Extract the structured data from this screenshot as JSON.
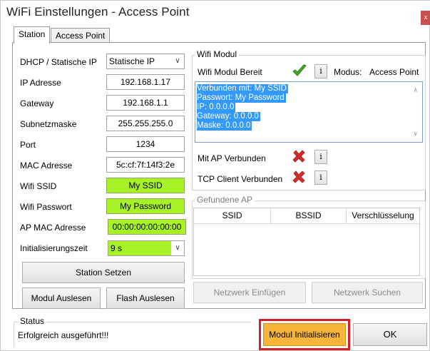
{
  "window": {
    "title": "WiFi Einstellungen - Access Point",
    "close_label": "x"
  },
  "tabs": [
    {
      "label": "Station",
      "active": true
    },
    {
      "label": "Access Point",
      "active": false
    }
  ],
  "station": {
    "fields": {
      "dhcp": {
        "label": "DHCP / Statische IP",
        "value": "Statische IP"
      },
      "ip": {
        "label": "IP Adresse",
        "value": "192.168.1.17"
      },
      "gateway": {
        "label": "Gateway",
        "value": "192.168.1.1"
      },
      "subnet": {
        "label": "Subnetzmaske",
        "value": "255.255.255.0"
      },
      "port": {
        "label": "Port",
        "value": "1234"
      },
      "mac": {
        "label": "MAC Adresse",
        "value": "5c:cf:7f:14f3:2e"
      },
      "ssid": {
        "label": "Wifi SSID",
        "value": "My SSID"
      },
      "password": {
        "label": "Wifi Passwort",
        "value": "My Password"
      },
      "ap_mac": {
        "label": "AP MAC Adresse",
        "value": "00:00:00:00:00:00"
      },
      "init_time": {
        "label": "Initialisierungszeit",
        "value": "9 s"
      }
    },
    "buttons": {
      "station_setzen": "Station Setzen",
      "modul_auslesen": "Modul Auslesen",
      "flash_auslesen": "Flash Auslesen"
    }
  },
  "wifi_modul": {
    "group_title": "Wifi Modul",
    "ready_label": "Wifi Modul Bereit",
    "info_label": "i",
    "modus_label": "Modus:",
    "modus_value": "Access Point",
    "log_lines": [
      "Verbunden mit: My SSID",
      "Passwort: My Password",
      "IP: 0.0.0.0",
      "Gateway: 0.0.0.0",
      "Maske: 0.0.0.0"
    ],
    "ap_connected_label": "Mit AP Verbunden",
    "tcp_connected_label": "TCP Client Verbunden",
    "status_colors": {
      "ok": "#4aa82a",
      "error": "#d62c2c"
    }
  },
  "found_ap": {
    "group_title": "Gefundene AP",
    "columns": [
      "SSID",
      "BSSID",
      "Verschlüsselung"
    ],
    "rows": [],
    "buttons": {
      "insert": "Netzwerk Einfügen",
      "search": "Netzwerk Suchen"
    }
  },
  "status": {
    "group_title": "Status",
    "message": "Erfolgreich ausgeführt!!!"
  },
  "footer_buttons": {
    "init": "Modul Initialisieren",
    "ok": "OK"
  },
  "colors": {
    "field_green": "#a7f227",
    "init_button": "#f6b53a",
    "highlight": "#d2202a",
    "selection": "#3399ff"
  }
}
